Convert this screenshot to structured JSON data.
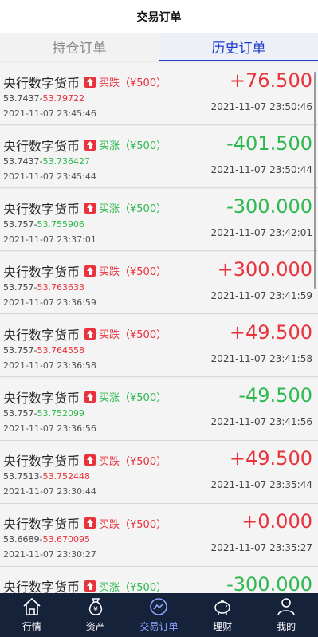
{
  "header": {
    "title": "交易订单"
  },
  "tabs": [
    {
      "label": "持仓订单",
      "active": false
    },
    {
      "label": "历史订单",
      "active": true
    }
  ],
  "orders": [
    {
      "name": "央行数字货币",
      "direction": "买跌（¥500）",
      "dir_color": "red",
      "open_price": "53.7437",
      "close_price": "53.79722",
      "close_color": "red",
      "open_time": "2021-11-07 23:45:46",
      "profit": "+76.500",
      "profit_color": "red",
      "close_time": "2021-11-07 23:50:46"
    },
    {
      "name": "央行数字货币",
      "direction": "买涨（¥500）",
      "dir_color": "green",
      "open_price": "53.7437",
      "close_price": "53.736427",
      "close_color": "green",
      "open_time": "2021-11-07 23:45:44",
      "profit": "-401.500",
      "profit_color": "green",
      "close_time": "2021-11-07 23:50:44"
    },
    {
      "name": "央行数字货币",
      "direction": "买涨（¥500）",
      "dir_color": "green",
      "open_price": "53.757",
      "close_price": "53.755906",
      "close_color": "green",
      "open_time": "2021-11-07 23:37:01",
      "profit": "-300.000",
      "profit_color": "green",
      "close_time": "2021-11-07 23:42:01"
    },
    {
      "name": "央行数字货币",
      "direction": "买跌（¥500）",
      "dir_color": "red",
      "open_price": "53.757",
      "close_price": "53.763633",
      "close_color": "red",
      "open_time": "2021-11-07 23:36:59",
      "profit": "+300.000",
      "profit_color": "red",
      "close_time": "2021-11-07 23:41:59"
    },
    {
      "name": "央行数字货币",
      "direction": "买跌（¥500）",
      "dir_color": "red",
      "open_price": "53.757",
      "close_price": "53.764558",
      "close_color": "red",
      "open_time": "2021-11-07 23:36:58",
      "profit": "+49.500",
      "profit_color": "red",
      "close_time": "2021-11-07 23:41:58"
    },
    {
      "name": "央行数字货币",
      "direction": "买涨（¥500）",
      "dir_color": "green",
      "open_price": "53.757",
      "close_price": "53.752099",
      "close_color": "green",
      "open_time": "2021-11-07 23:36:56",
      "profit": "-49.500",
      "profit_color": "green",
      "close_time": "2021-11-07 23:41:56"
    },
    {
      "name": "央行数字货币",
      "direction": "买跌（¥500）",
      "dir_color": "red",
      "open_price": "53.7513",
      "close_price": "53.752448",
      "close_color": "red",
      "open_time": "2021-11-07 23:30:44",
      "profit": "+49.500",
      "profit_color": "red",
      "close_time": "2021-11-07 23:35:44"
    },
    {
      "name": "央行数字货币",
      "direction": "买跌（¥500）",
      "dir_color": "red",
      "open_price": "53.6689",
      "close_price": "53.670095",
      "close_color": "red",
      "open_time": "2021-11-07 23:30:27",
      "profit": "+0.000",
      "profit_color": "red",
      "close_time": "2021-11-07 23:35:27"
    },
    {
      "name": "央行数字货币",
      "direction": "买涨（¥500）",
      "dir_color": "green",
      "open_price": "",
      "close_price": "",
      "close_color": "green",
      "open_time": "",
      "profit": "-300.000",
      "profit_color": "green",
      "close_time": ""
    }
  ],
  "nav": [
    {
      "label": "行情",
      "icon": "home-icon",
      "active": false
    },
    {
      "label": "资产",
      "icon": "money-bag-icon",
      "active": false
    },
    {
      "label": "交易订单",
      "icon": "trend-chart-icon",
      "active": true
    },
    {
      "label": "理财",
      "icon": "piggy-bank-icon",
      "active": false
    },
    {
      "label": "我的",
      "icon": "user-icon",
      "active": false
    }
  ]
}
